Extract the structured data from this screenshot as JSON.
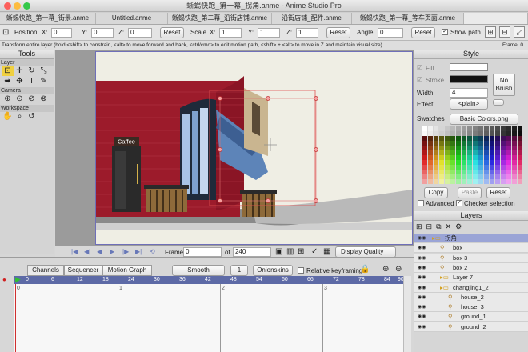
{
  "window": {
    "title": "蜥蜴快跑_第一幕_拐角.anme - Anime Studio Pro"
  },
  "doc_tabs": [
    {
      "label": "蜥蜴快跑_第一幕_街景.anme",
      "active": false
    },
    {
      "label": "Untitled.anme",
      "active": false
    },
    {
      "label": "蜥蜴快跑_第二幕_沿街店铺.anme",
      "active": false
    },
    {
      "label": "沿街店铺_配件.anme",
      "active": false
    },
    {
      "label": "蜥蜴快跑_第一幕_等车页面.anme",
      "active": false
    },
    {
      "label": "",
      "active": true
    }
  ],
  "toolbar": {
    "position_label": "Position",
    "x_label": "X:",
    "x": "0",
    "y_label": "Y:",
    "y": "0",
    "z_label": "Z:",
    "z": "0",
    "reset1": "Reset",
    "scale_label": "Scale",
    "sx_label": "X:",
    "sx": "1",
    "sy_label": "Y:",
    "sy": "1",
    "sz_label": "Z:",
    "sz": "1",
    "reset2": "Reset",
    "angle_label": "Angle:",
    "angle": "0",
    "reset3": "Reset",
    "show_path": "Show path"
  },
  "infobar": {
    "hint": "Transform entire layer (hold <shift> to constrain, <alt> to move forward and back, <ctrl/cmd> to edit motion path, <shift> + <alt> to move in Z and maintain visual size)",
    "frame": "Frame: 0"
  },
  "tools": {
    "title": "Tools",
    "layer": "Layer",
    "camera": "Camera",
    "workspace": "Workspace"
  },
  "scene": {
    "sign": "Caffee"
  },
  "framebar": {
    "frame_label": "Frame",
    "frame": "0",
    "of_label": "of",
    "total": "240",
    "display_quality": "Display Quality"
  },
  "timeline": {
    "tabs": [
      "Channels",
      "Sequencer",
      "Motion Graph"
    ],
    "smooth": "Smooth",
    "one": "1",
    "onionskins": "Onionskins",
    "relative": "Relative keyframing",
    "ruler": [
      "0",
      "6",
      "12",
      "18",
      "24",
      "30",
      "36",
      "42",
      "48",
      "54",
      "60",
      "66",
      "72",
      "78",
      "84",
      "90"
    ],
    "markers": [
      "0",
      "1",
      "2",
      "3"
    ]
  },
  "style": {
    "title": "Style",
    "fill": "Fill",
    "stroke": "Stroke",
    "width_label": "Width",
    "width": "4",
    "effect_label": "Effect",
    "effect": "<plain>",
    "no_brush": "No\nBrush",
    "swatches_label": "Swatches",
    "swatches_file": "Basic Colors.png",
    "copy": "Copy",
    "paste": "Paste",
    "reset": "Reset",
    "advanced": "Advanced",
    "checker": "Checker selection"
  },
  "layers": {
    "title": "Layers",
    "rows": [
      {
        "label": "拐角",
        "indent": 0,
        "kind": "group",
        "sel": true
      },
      {
        "label": "box",
        "indent": 1,
        "kind": "bone",
        "sel": false
      },
      {
        "label": "box 3",
        "indent": 1,
        "kind": "bone",
        "sel": false
      },
      {
        "label": "box 2",
        "indent": 1,
        "kind": "bone",
        "sel": false
      },
      {
        "label": "Layer 7",
        "indent": 1,
        "kind": "group",
        "sel": false
      },
      {
        "label": "changjing1_2",
        "indent": 1,
        "kind": "group",
        "sel": false
      },
      {
        "label": "house_2",
        "indent": 2,
        "kind": "bone",
        "sel": false
      },
      {
        "label": "house_3",
        "indent": 2,
        "kind": "bone",
        "sel": false
      },
      {
        "label": "ground_1",
        "indent": 2,
        "kind": "bone",
        "sel": false
      },
      {
        "label": "ground_2",
        "indent": 2,
        "kind": "bone",
        "sel": false
      }
    ]
  },
  "colors": {
    "accent": "#5d6aa6",
    "brick": "#9c1b2b",
    "selected_layer": "#9aa4d6"
  },
  "icons": [
    "search-icon",
    "play-icon",
    "gear-icon"
  ]
}
